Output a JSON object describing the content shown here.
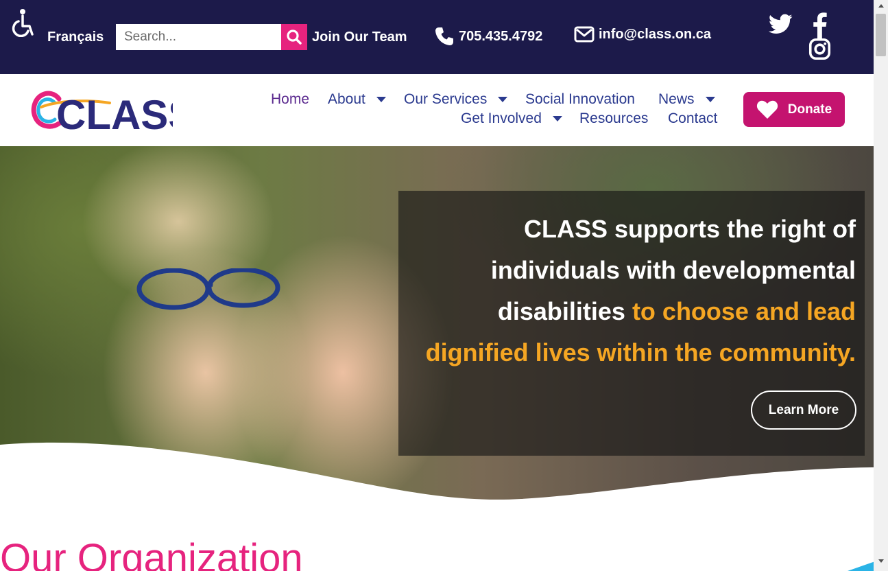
{
  "topbar": {
    "accessibility_icon": "wheelchair-icon",
    "language_link": "Français",
    "search": {
      "placeholder": "Search...",
      "icon": "search-icon"
    },
    "join_link": "Join Our Team",
    "phone": {
      "icon": "phone-icon",
      "text": "705.435.4792"
    },
    "email": {
      "icon": "envelope-icon",
      "text": "info@class.on.ca"
    },
    "social": [
      "twitter-icon",
      "facebook-icon",
      "instagram-icon"
    ]
  },
  "header": {
    "logo_text": "CLASS",
    "nav": {
      "home": "Home",
      "about": "About",
      "services": "Our Services",
      "social_innovation": "Social Innovation",
      "news": "News",
      "get_involved": "Get Involved",
      "resources": "Resources",
      "contact": "Contact"
    },
    "donate": {
      "label": "Donate",
      "icon": "heart-icon"
    }
  },
  "hero": {
    "line1": "CLASS supports the right of",
    "line2": "individuals with developmental",
    "line3_white": "disabilities ",
    "line3_highlight": "to choose and lead",
    "line4_highlight": "dignified lives within the community.",
    "button": "Learn More"
  },
  "section": {
    "title": "Our Organization"
  },
  "colors": {
    "topbar_bg": "#1c1a4a",
    "nav_text": "#2b3a8f",
    "accent_pink": "#e6237e",
    "donate_bg": "#c4136f",
    "highlight_orange": "#f5a623"
  }
}
